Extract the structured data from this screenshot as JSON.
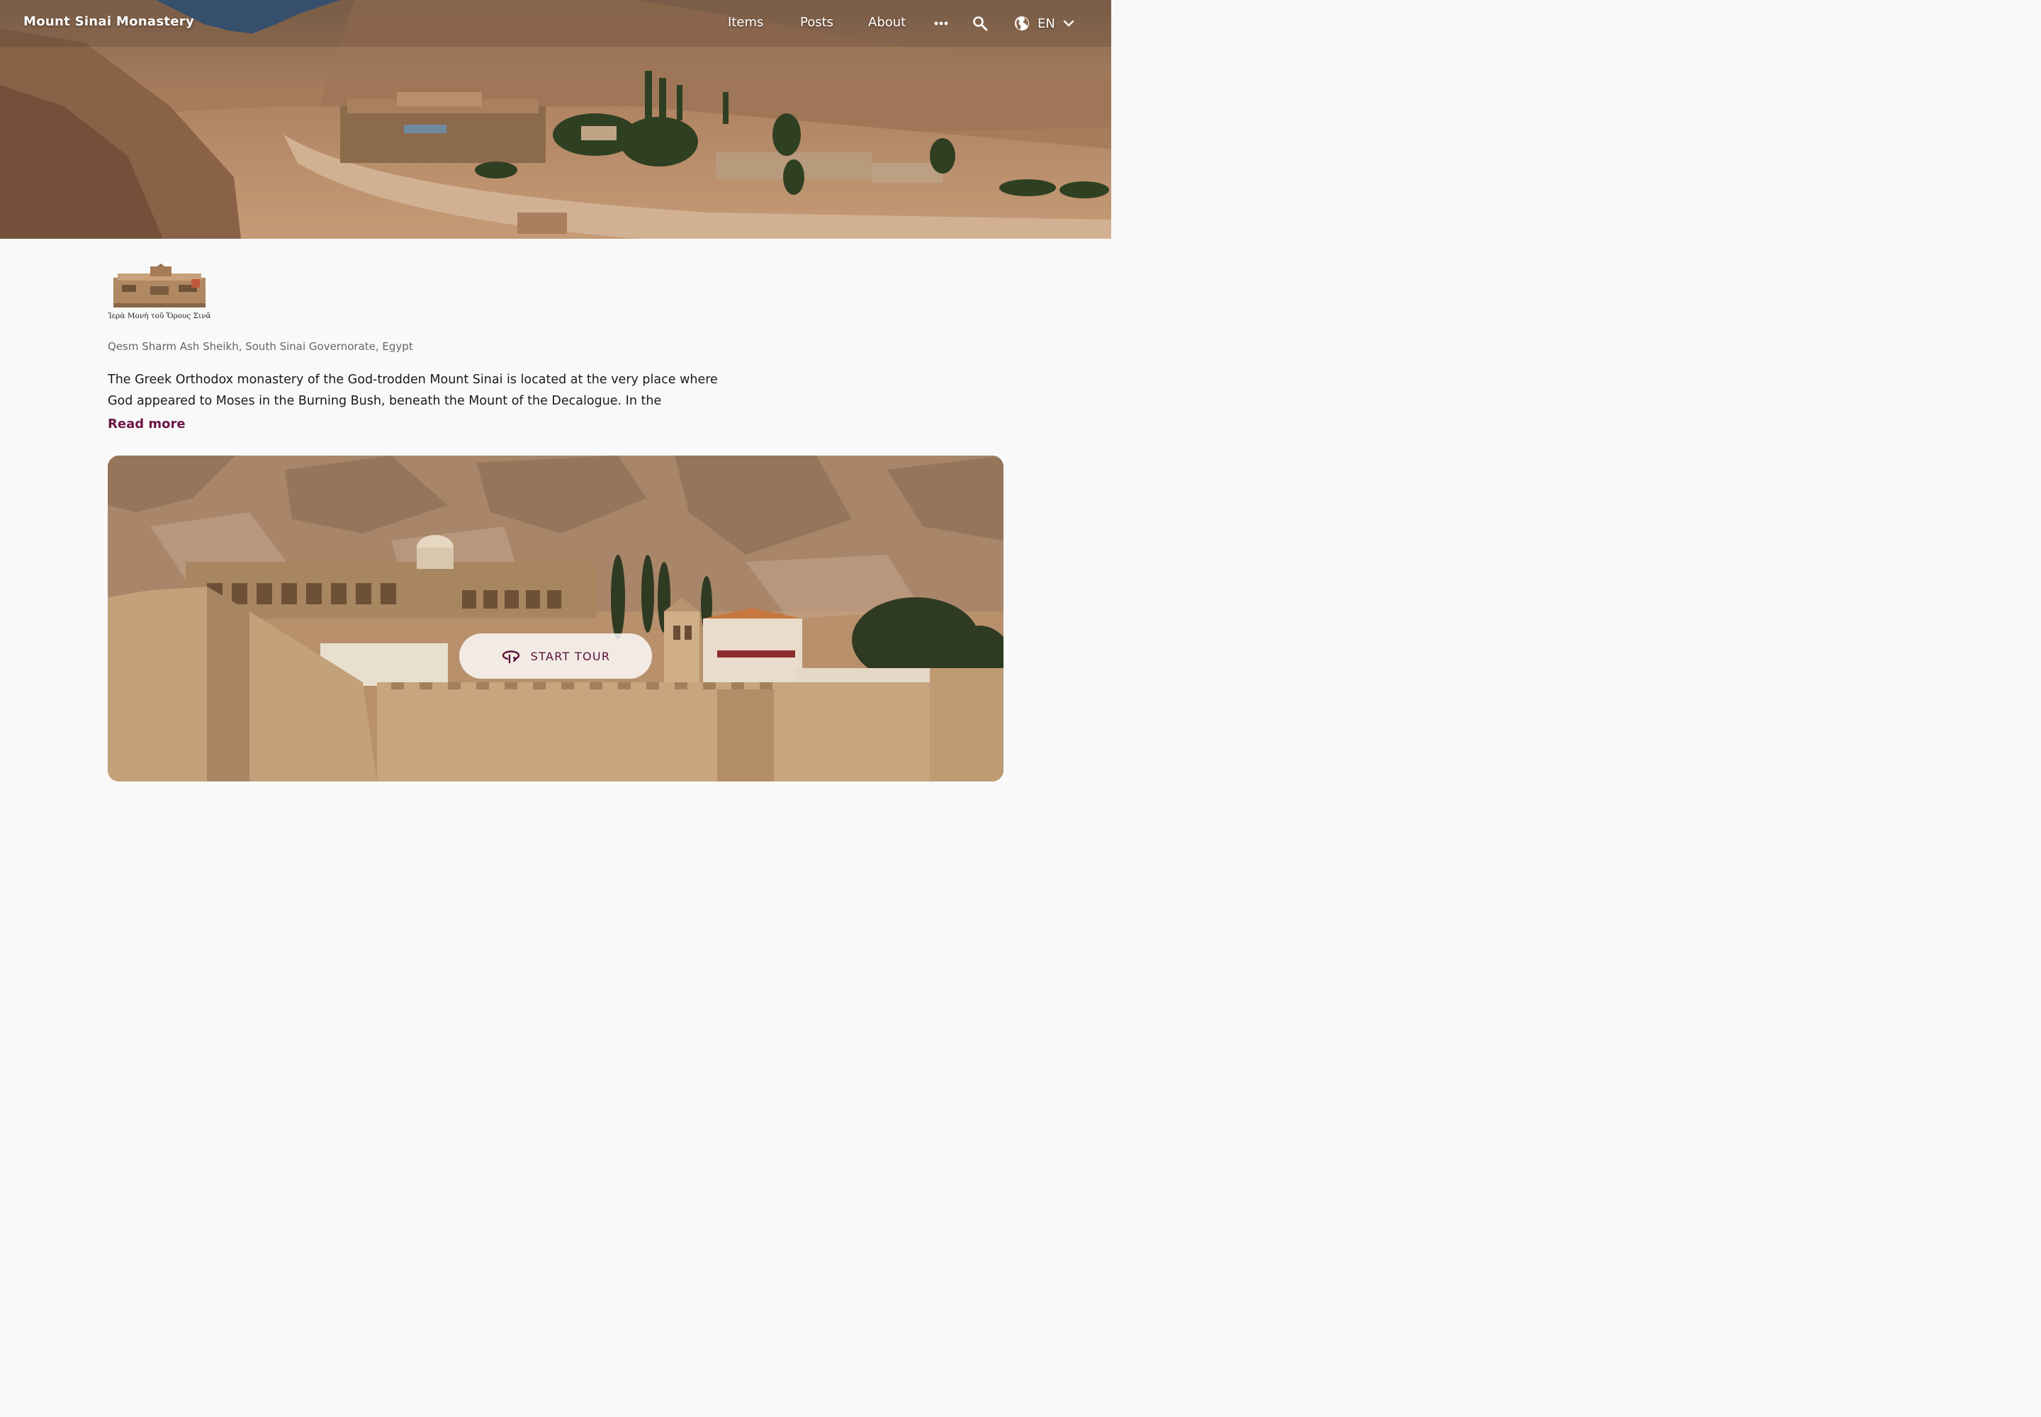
{
  "header": {
    "site_title": "Mount Sinai Monastery",
    "nav": {
      "items": "Items",
      "posts": "Posts",
      "about": "About"
    },
    "language": "EN"
  },
  "logo": {
    "caption": "Ἱερὰ Μονὴ τοῦ Ὄρους Σινᾶ"
  },
  "place": {
    "location": "Qesm Sharm Ash Sheikh, South Sinai Governorate, Egypt",
    "description": "The Greek Orthodox monastery of the God-trodden Mount Sinai is located at the very place where God appeared to Moses in the Burning Bush, beneath the Mount of the Decalogue. In the providence of God, it",
    "read_more": "Read more"
  },
  "tour": {
    "button_label": "START TOUR",
    "button_icon": "360-rotate-icon"
  },
  "colors": {
    "accent": "#6b1744",
    "tour_text": "#5b1038"
  }
}
